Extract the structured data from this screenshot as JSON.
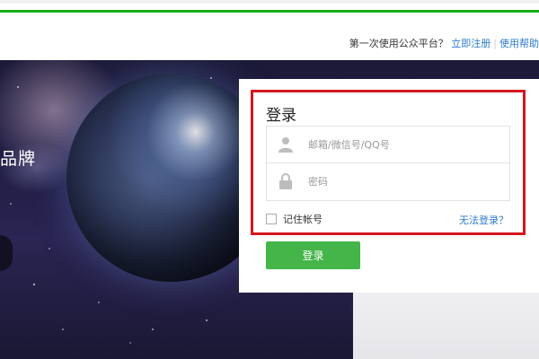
{
  "header": {
    "question": "第一次使用公众平台？",
    "register_link": "立即注册",
    "separator": "|",
    "help_link": "使用帮助"
  },
  "banner": {
    "brand_text": "品牌"
  },
  "login": {
    "title": "登录",
    "username_placeholder": "邮箱/微信号/QQ号",
    "password_placeholder": "密码",
    "remember_label": "记住帐号",
    "forgot_link": "无法登录？",
    "login_button": "登录"
  },
  "colors": {
    "accent_green": "#44b549",
    "link_blue": "#2b7acb",
    "highlight_red": "#d4181f"
  },
  "icons": {
    "user": "user-icon",
    "lock": "lock-icon"
  }
}
